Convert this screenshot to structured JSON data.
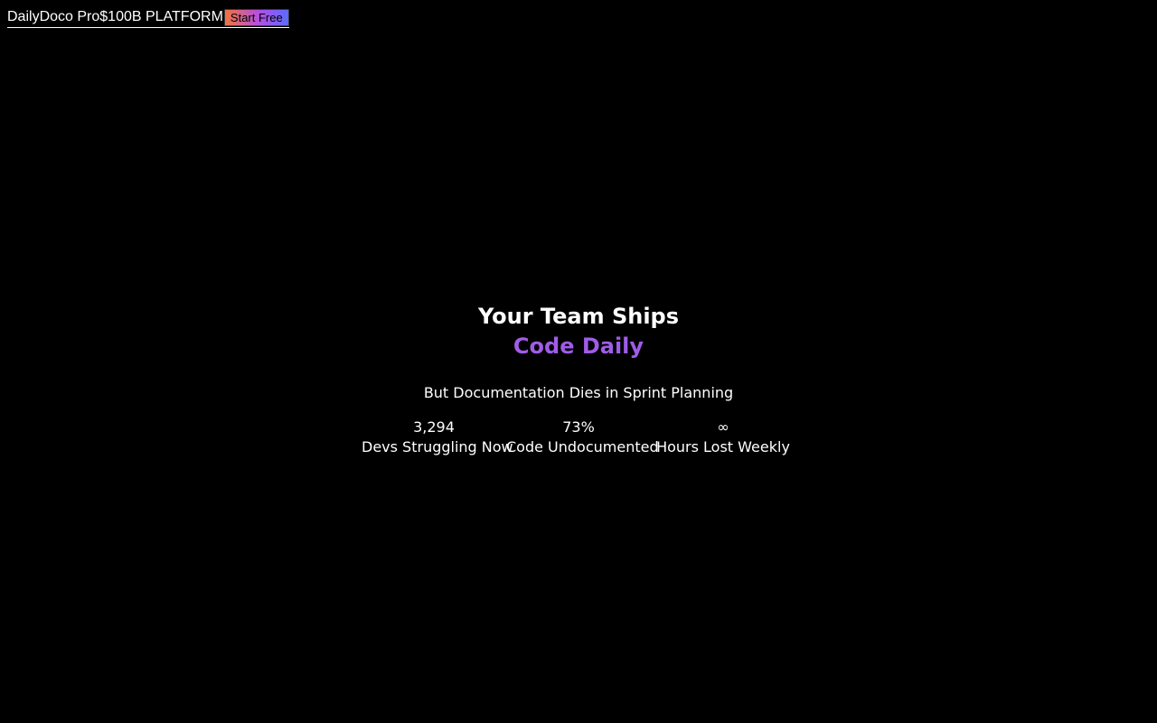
{
  "header": {
    "brand": "DailyDoco Pro",
    "badge": "$100B PLATFORM",
    "cta_label": "Start Free"
  },
  "hero": {
    "headline_line1": "Your Team Ships",
    "headline_line2": "Code Daily",
    "subheadline": "But Documentation Dies in Sprint Planning",
    "stats": [
      {
        "value": "3,294",
        "label": "Devs Struggling Now"
      },
      {
        "value": "73%",
        "label": "Code Undocumented"
      },
      {
        "value": "∞",
        "label": "Hours Lost Weekly"
      }
    ]
  },
  "colors": {
    "background": "#000000",
    "text": "#ffffff",
    "accent_gradient_start": "#f0733f",
    "accent_gradient_mid": "#b14fe6",
    "accent_gradient_end": "#5a6cff",
    "highlight_text": "#a45ee5"
  }
}
